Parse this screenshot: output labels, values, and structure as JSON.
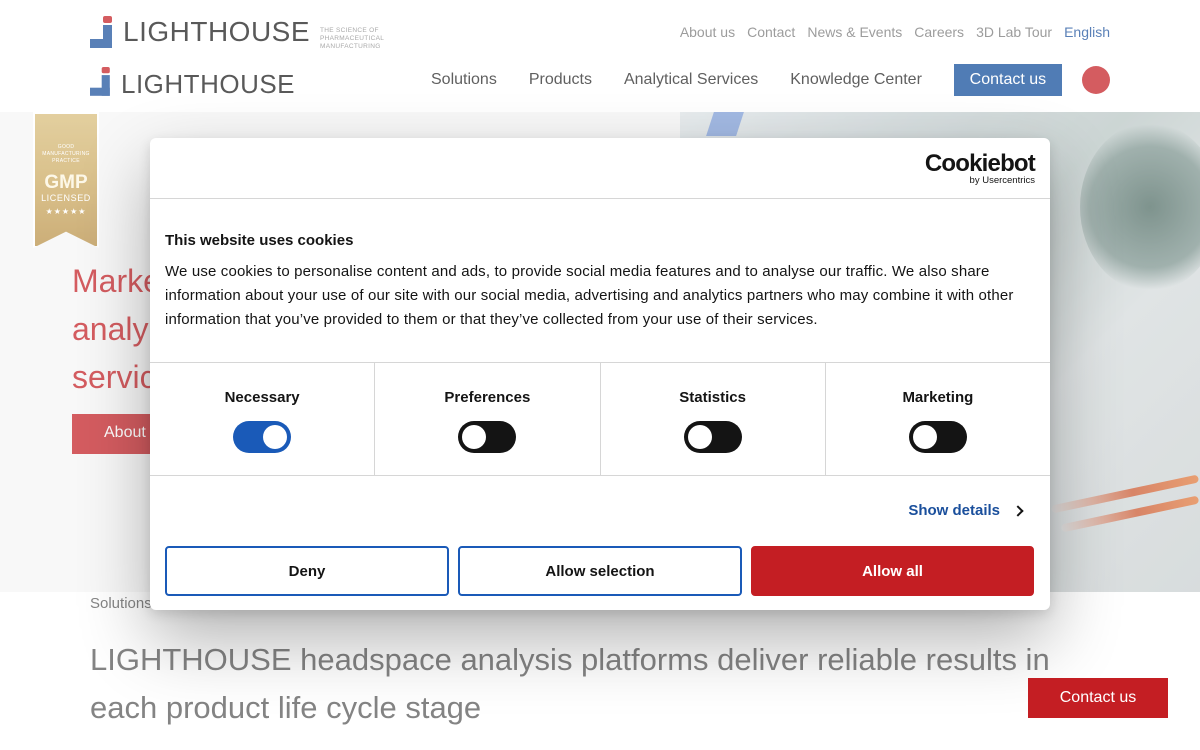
{
  "header": {
    "logo_text": "LIGHTHOUSE",
    "tagline": "THE SCIENCE OF PHARMACEUTICAL MANUFACTURING",
    "top_links": [
      "About us",
      "Contact",
      "News & Events",
      "Careers",
      "3D Lab Tour"
    ],
    "language": "English",
    "nav": [
      "Solutions",
      "Products",
      "Analytical Services",
      "Knowledge Center"
    ],
    "contact_label": "Contact us"
  },
  "hero": {
    "title_fragments": [
      "Marke",
      "analy",
      "servic"
    ],
    "button_fragment": "About",
    "badge": {
      "small_text": "GOOD MANUFACTURING PRACTICE",
      "big_text": "GMP",
      "licensed": "LICENSED",
      "stars": "★★★★★"
    }
  },
  "cookie_dialog": {
    "brand": "Cookiebot",
    "brand_sub": "by Usercentrics",
    "title": "This website uses cookies",
    "body": "We use cookies to personalise content and ads, to provide social media features and to analyse our traffic. We also share information about your use of our site with our social media, advertising and analytics partners who may combine it with other information that you’ve provided to them or that they’ve collected from your use of their services.",
    "toggles": [
      {
        "label": "Necessary",
        "on": true
      },
      {
        "label": "Preferences",
        "on": false
      },
      {
        "label": "Statistics",
        "on": false
      },
      {
        "label": "Marketing",
        "on": false
      }
    ],
    "show_details": "Show details",
    "buttons": {
      "deny": "Deny",
      "allow_selection": "Allow selection",
      "allow_all": "Allow all"
    }
  },
  "content": {
    "breadcrumb": "Solutions",
    "heading": "LIGHTHOUSE headspace analysis platforms deliver reliable results in each product life cycle stage"
  },
  "floating_contact": "Contact us",
  "colors": {
    "brand_red": "#c41e23",
    "brand_blue": "#1a4f9c",
    "toggle_on": "#1a5ab8"
  }
}
